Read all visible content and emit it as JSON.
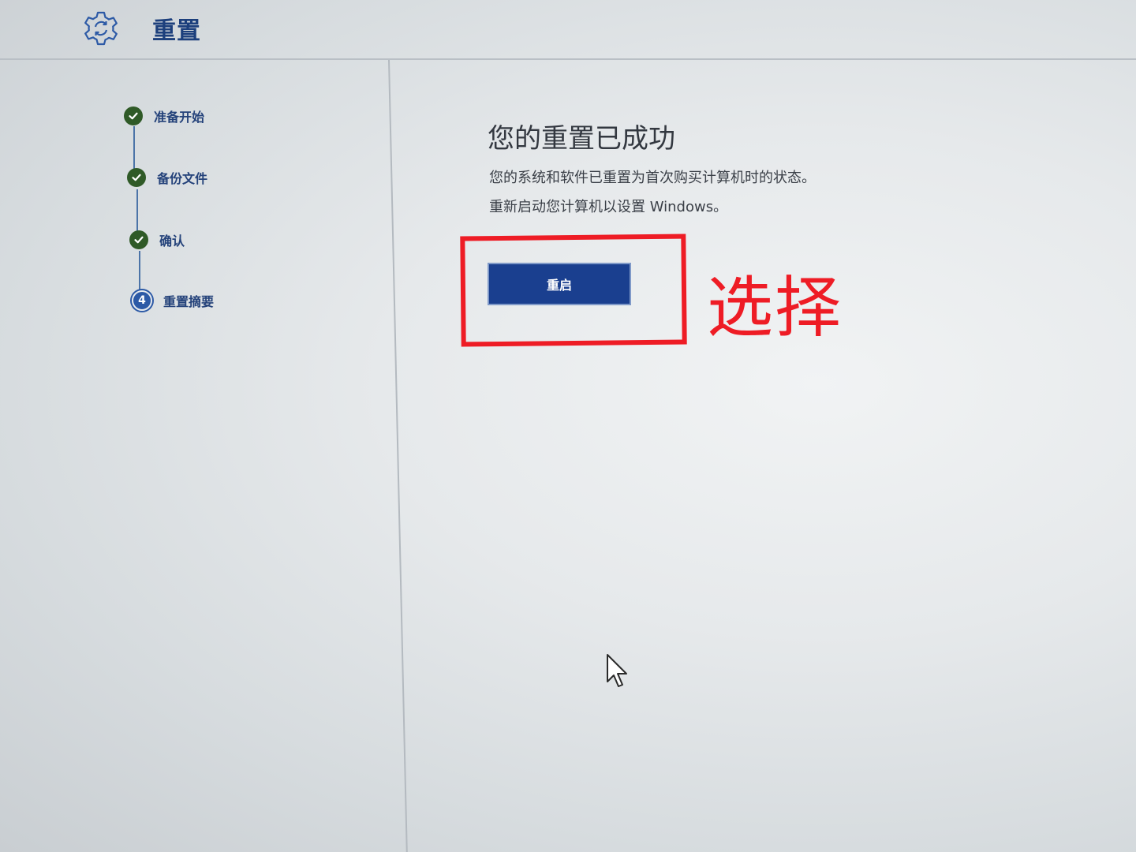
{
  "header": {
    "title": "重置",
    "icon": "settings-gear-icon"
  },
  "steps": [
    {
      "label": "准备开始",
      "status": "done"
    },
    {
      "label": "备份文件",
      "status": "done"
    },
    {
      "label": "确认",
      "status": "done"
    },
    {
      "label": "重置摘要",
      "status": "current",
      "number": "4"
    }
  ],
  "main": {
    "title": "您的重置已成功",
    "line1": "您的系统和软件已重置为首次购买计算机时的状态。",
    "line2": "重新启动您计算机以设置 Windows。",
    "restart_label": "重启"
  },
  "annotation": {
    "text": "选择",
    "color": "#ee1c25"
  },
  "colors": {
    "accent": "#1a3f8f",
    "done": "#2f5a27",
    "header_text": "#1c3f7c"
  }
}
